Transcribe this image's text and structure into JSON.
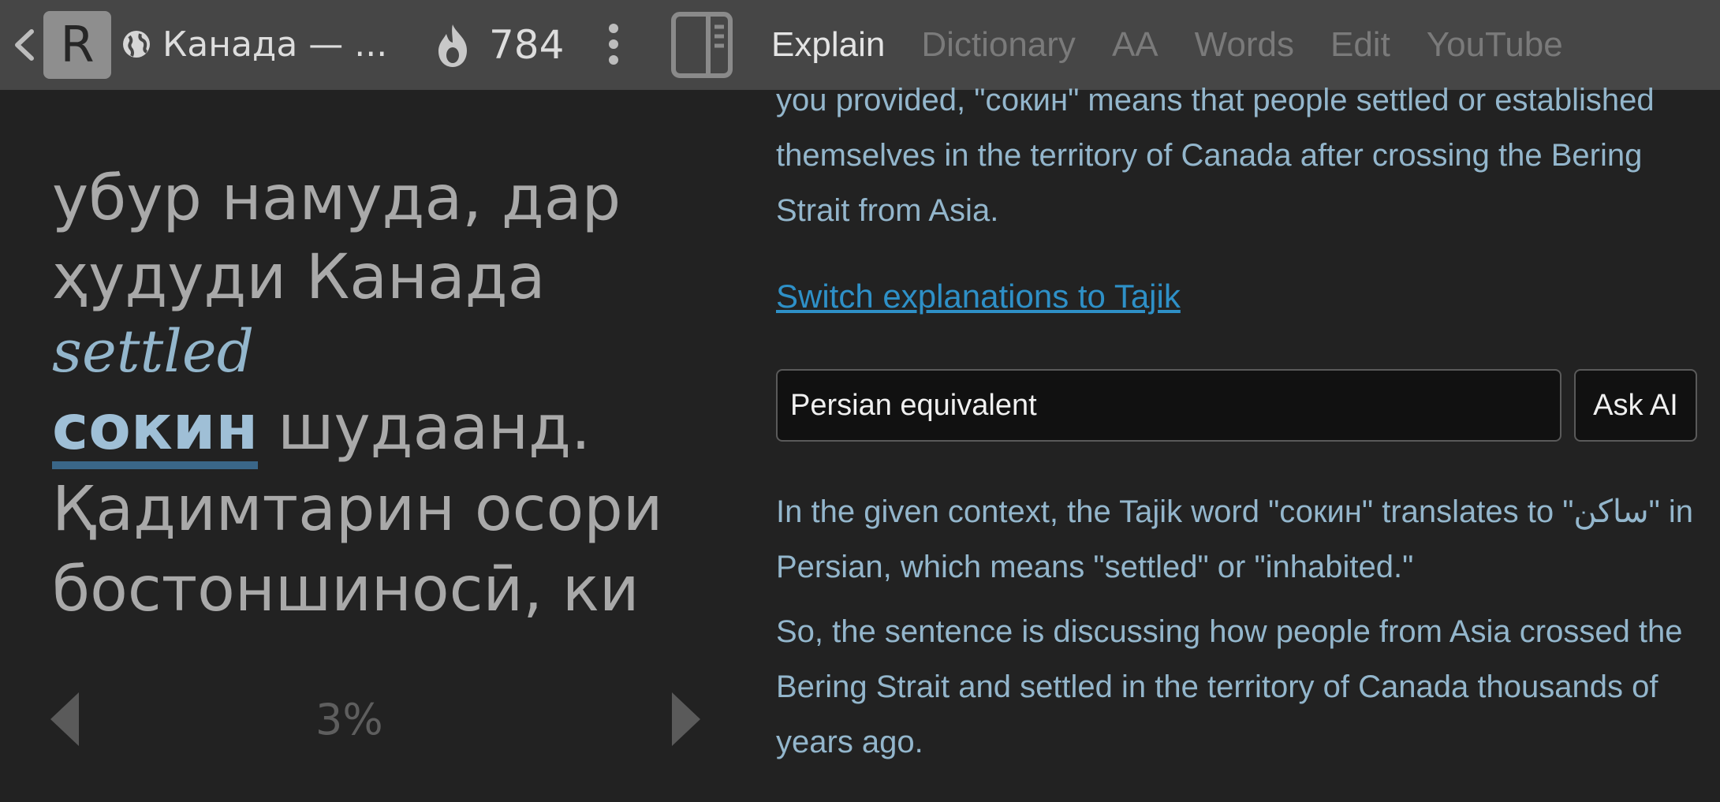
{
  "topbar": {
    "document_title": "Канада — ...",
    "streak_count": "784",
    "logo_letter": "R",
    "icons": {
      "back": "chevron-left-icon",
      "globe": "globe-icon",
      "flame": "flame-icon",
      "more": "kebab-menu-icon",
      "panel": "panel-toggle-icon"
    },
    "tabs": [
      {
        "label": "Explain",
        "active": true
      },
      {
        "label": "Dictionary",
        "active": false
      },
      {
        "label": "AA",
        "active": false
      },
      {
        "label": "Words",
        "active": false
      },
      {
        "label": "Edit",
        "active": false
      },
      {
        "label": "YouTube",
        "active": false
      }
    ]
  },
  "reader": {
    "line1": "убур намуда, дар",
    "line2": "ҳудуди Канада",
    "gloss": "settled",
    "selected_word": "сокин",
    "line3_rest": " шудаанд.",
    "line4": "Қадимтарин осори",
    "line5": "бостоншиносӣ, ки",
    "progress": "3%",
    "icons": {
      "prev": "prev-page-arrow-icon",
      "next": "next-page-arrow-icon"
    }
  },
  "explain": {
    "intro": "you provided, \"сокин\" means that people settled or established themselves in the territory of Canada after crossing the Bering Strait from Asia.",
    "switch_link": "Switch explanations to Tajik",
    "question_value": "Persian equivalent",
    "ask_button": "Ask AI",
    "answer_p1": "In the given context, the Tajik word \"сокин\" translates to \"ساکن\" in Persian, which means \"settled\" or \"inhabited.\"",
    "answer_p2": "So, the sentence is discussing how people from Asia crossed the Bering Strait and settled in the territory of Canada thousands of years ago."
  },
  "colors": {
    "topbar_bg": "#464646",
    "page_bg": "#222222",
    "explain_text": "#93b6cc",
    "link": "#2e90c7",
    "highlight_underline": "#3a6688"
  }
}
